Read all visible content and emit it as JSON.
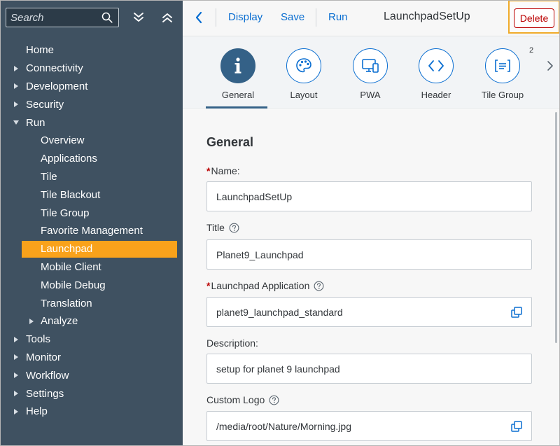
{
  "sidebar": {
    "search": {
      "placeholder": "Search"
    },
    "menu": [
      {
        "label": "Home",
        "level": 1,
        "caret": "none"
      },
      {
        "label": "Connectivity",
        "level": 1,
        "caret": "right"
      },
      {
        "label": "Development",
        "level": 1,
        "caret": "right"
      },
      {
        "label": "Security",
        "level": 1,
        "caret": "right"
      },
      {
        "label": "Run",
        "level": 1,
        "caret": "down"
      },
      {
        "label": "Overview",
        "level": 2,
        "caret": "none"
      },
      {
        "label": "Applications",
        "level": 2,
        "caret": "none"
      },
      {
        "label": "Tile",
        "level": 2,
        "caret": "none"
      },
      {
        "label": "Tile Blackout",
        "level": 2,
        "caret": "none"
      },
      {
        "label": "Tile Group",
        "level": 2,
        "caret": "none"
      },
      {
        "label": "Favorite Management",
        "level": 2,
        "caret": "none"
      },
      {
        "label": "Launchpad",
        "level": 2,
        "caret": "none",
        "selected": true
      },
      {
        "label": "Mobile Client",
        "level": 2,
        "caret": "none"
      },
      {
        "label": "Mobile Debug",
        "level": 2,
        "caret": "none"
      },
      {
        "label": "Translation",
        "level": 2,
        "caret": "none"
      },
      {
        "label": "Analyze",
        "level": 2,
        "caret": "right"
      },
      {
        "label": "Tools",
        "level": 1,
        "caret": "right"
      },
      {
        "label": "Monitor",
        "level": 1,
        "caret": "right"
      },
      {
        "label": "Workflow",
        "level": 1,
        "caret": "right"
      },
      {
        "label": "Settings",
        "level": 1,
        "caret": "right"
      },
      {
        "label": "Help",
        "level": 1,
        "caret": "right"
      }
    ]
  },
  "toolbar": {
    "display_label": "Display",
    "save_label": "Save",
    "run_label": "Run",
    "title": "LaunchpadSetUp",
    "delete_label": "Delete"
  },
  "tabs": [
    {
      "label": "General",
      "icon": "info-icon",
      "active": true
    },
    {
      "label": "Layout",
      "icon": "palette-icon"
    },
    {
      "label": "PWA",
      "icon": "devices-icon"
    },
    {
      "label": "Header",
      "icon": "code-icon"
    },
    {
      "label": "Tile Group",
      "icon": "list-icon",
      "badge": "2"
    }
  ],
  "form": {
    "section_title": "General",
    "name": {
      "label": "Name:",
      "required": true,
      "value": "LaunchpadSetUp"
    },
    "title": {
      "label": "Title",
      "value": "Planet9_Launchpad"
    },
    "launchpad_application": {
      "label": "Launchpad Application",
      "required": true,
      "value": "planet9_launchpad_standard"
    },
    "description": {
      "label": "Description:",
      "value": "setup for planet 9 launchpad"
    },
    "custom_logo": {
      "label": "Custom Logo",
      "value": "/media/root/Nature/Morning.jpg"
    }
  },
  "colors": {
    "sidebar_bg": "#3f5161",
    "selected_bg": "#f9a21b",
    "accent": "#0a6ed1",
    "active_tab": "#346187",
    "delete": "#bb0000",
    "highlight_frame": "#f0ab2a"
  }
}
